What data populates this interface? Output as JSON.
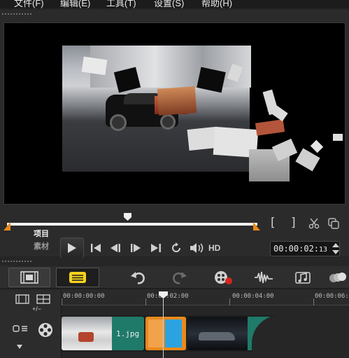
{
  "menu": {
    "items": [
      "文件(F)",
      "编辑(E)",
      "工具(T)",
      "设置(S)",
      "帮助(H)"
    ]
  },
  "preview": {
    "mode_project": "项目",
    "mode_clip": "素材",
    "bracket_in": "[",
    "bracket_out": "]",
    "hd_label": "HD",
    "timecode": "00:00:02:",
    "timecode_frames": "13",
    "scrub_position": 0.48
  },
  "timeline": {
    "zoom_label": "+/−",
    "ruler": [
      "00:00:00:00",
      "00:00:02:00",
      "00:00:04:00",
      "00:00:06:00"
    ],
    "clips": [
      {
        "name": "clip-photo-car-snow",
        "label": ""
      },
      {
        "name": "clip-jpg",
        "label": "1.jpg"
      },
      {
        "name": "clip-transition",
        "label": ""
      },
      {
        "name": "clip-photo-car-dark",
        "label": ""
      }
    ]
  },
  "colors": {
    "accent_orange": "#e8891c",
    "clip_teal": "#1f7a6a",
    "timeline_btn_yellow": "#f4d21c"
  },
  "icons": [
    "film-strip-icon",
    "timeline-view-icon",
    "undo-icon",
    "redo-icon",
    "record-icon",
    "audio-wave-icon",
    "score-icon",
    "more-icon",
    "track-manager-icon",
    "video-track-icon",
    "chain-icon"
  ]
}
